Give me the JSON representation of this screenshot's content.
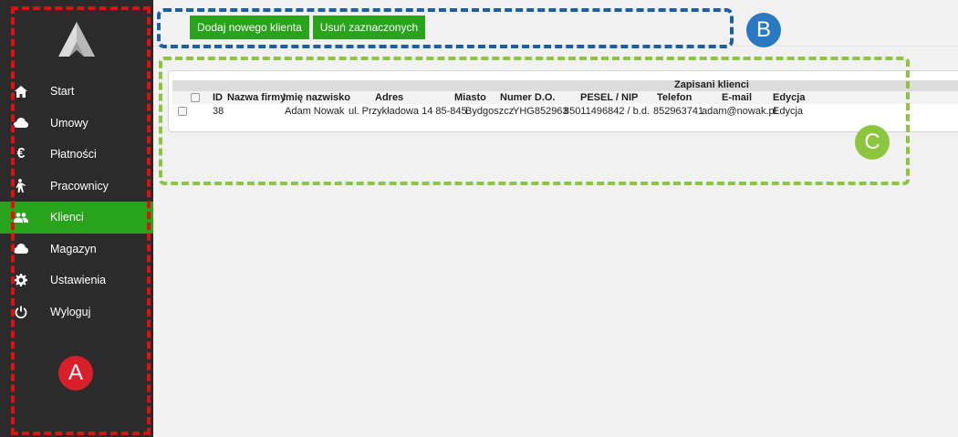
{
  "sidebar": {
    "items": [
      {
        "label": "Start",
        "icon": "home-icon",
        "active": false
      },
      {
        "label": "Umowy",
        "icon": "cloud-icon",
        "active": false
      },
      {
        "label": "Płatności",
        "icon": "euro-icon",
        "active": false
      },
      {
        "label": "Pracownicy",
        "icon": "worker-icon",
        "active": false
      },
      {
        "label": "Klienci",
        "icon": "users-icon",
        "active": true
      },
      {
        "label": "Magazyn",
        "icon": "cloud-icon",
        "active": false
      },
      {
        "label": "Ustawienia",
        "icon": "gear-icon",
        "active": false
      },
      {
        "label": "Wyloguj",
        "icon": "power-icon",
        "active": false
      }
    ]
  },
  "toolbar": {
    "add_label": "Dodaj nowego klienta",
    "delete_label": "Usuń zaznaczonych"
  },
  "table": {
    "caption": "Zapisani klienci",
    "columns": [
      "ID",
      "Nazwa firmy",
      "Imię nazwisko",
      "Adres",
      "Miasto",
      "Numer D.O.",
      "PESEL / NIP",
      "Telefon",
      "E-mail",
      "Edycja"
    ],
    "rows": [
      {
        "id": "38",
        "company": "",
        "name": "Adam Nowak",
        "address": "ul. Przykładowa 14 85-845",
        "city": "Bydgoszcz",
        "doc": "YHG852963",
        "pesel": "85011496842 / b.d.",
        "phone": "852963741",
        "email": "adam@nowak.pl",
        "edit": "Edycja"
      }
    ]
  },
  "annotations": {
    "a": "A",
    "b": "B",
    "c": "C"
  },
  "colors": {
    "accent": "#28a31b",
    "sidebar": "#2b2b2b",
    "marker_a": "#d8202a",
    "marker_b": "#2a78c0",
    "marker_c": "#8cc63f"
  }
}
